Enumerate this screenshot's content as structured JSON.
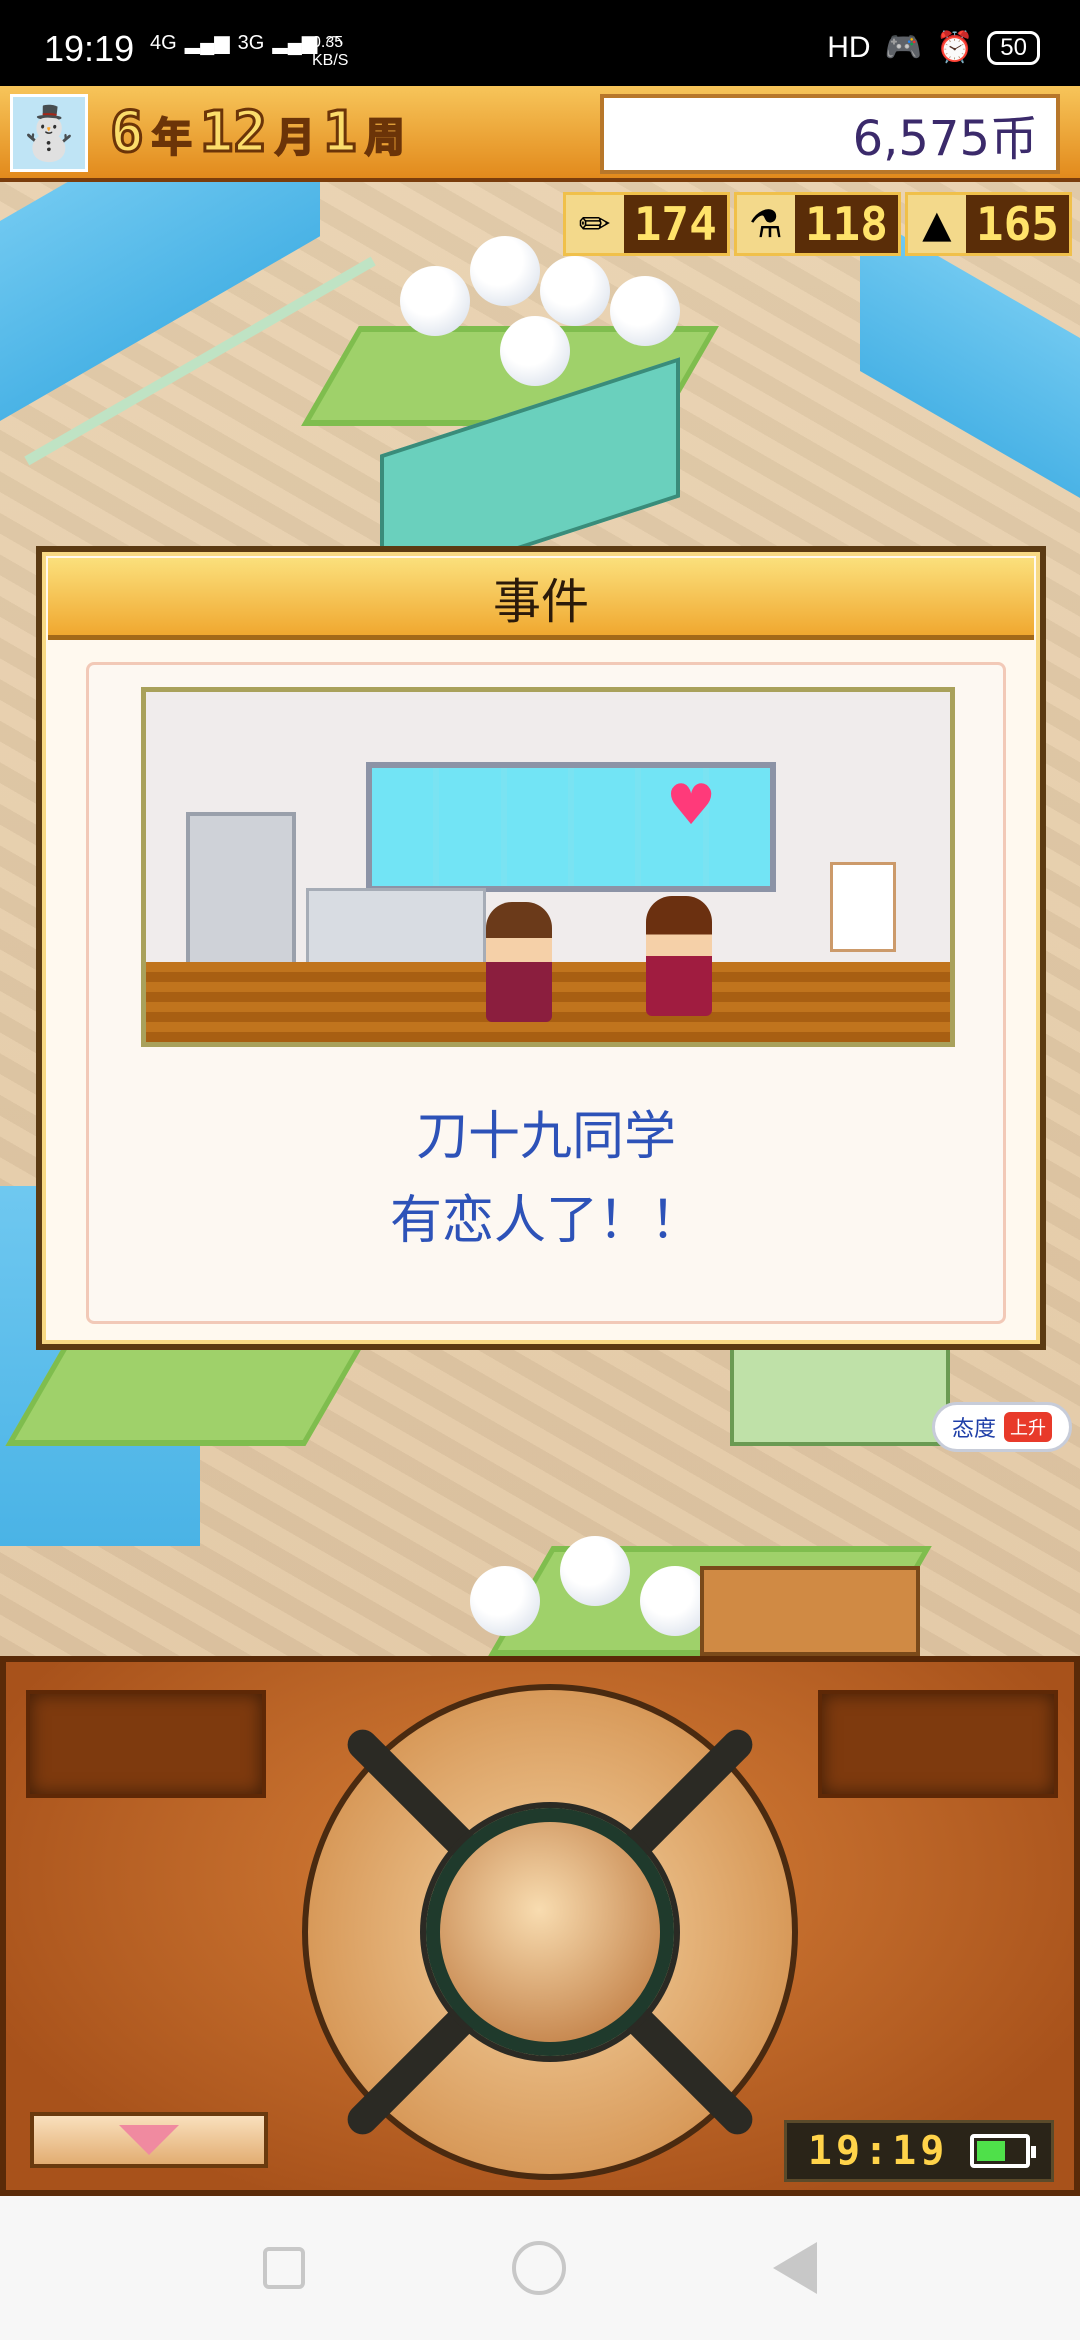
{
  "status_bar": {
    "time": "19:19",
    "net_4g": "4G",
    "net_3g": "3G",
    "speed_value": "0.35",
    "speed_unit": "KB/S",
    "hd_label": "HD",
    "battery": "50"
  },
  "top_bar": {
    "year": "6",
    "year_unit": "年",
    "month": "12",
    "month_unit": "月",
    "week": "1",
    "week_unit": "周",
    "money": "6,575币"
  },
  "resources": [
    {
      "icon": "pencil-icon",
      "value": "174"
    },
    {
      "icon": "flask-icon",
      "value": "118"
    },
    {
      "icon": "tower-icon",
      "value": "165"
    }
  ],
  "dialog": {
    "title": "事件",
    "message_line1": "刀十九同学",
    "message_line2": "有恋人了！！"
  },
  "badge": {
    "label": "态度",
    "arrow_text": "上升"
  },
  "controller": {
    "clock": "19:19"
  },
  "colors": {
    "accent_orange": "#e28a1c",
    "message_blue": "#2d52b8",
    "heart_pink": "#ff3a7a"
  }
}
